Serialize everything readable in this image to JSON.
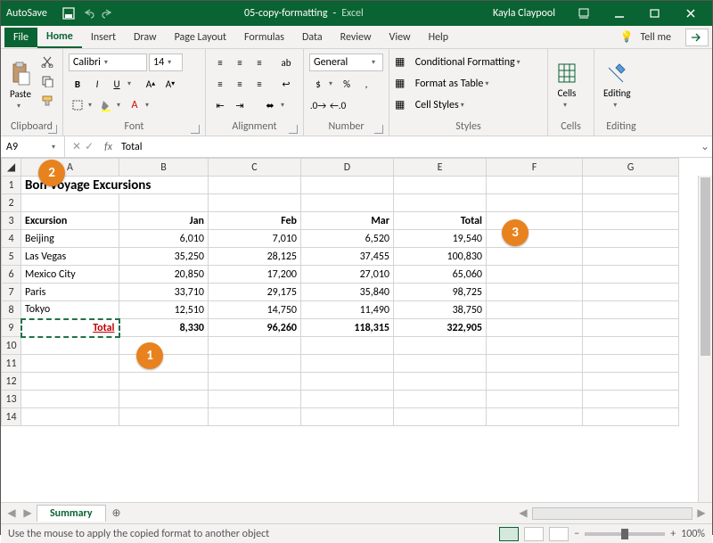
{
  "titlebar": {
    "autosave": "AutoSave",
    "doc": "05-copy-formatting",
    "app": "Excel",
    "user": "Kayla Claypool"
  },
  "menu": {
    "file": "File",
    "home": "Home",
    "insert": "Insert",
    "draw": "Draw",
    "pagelayout": "Page Layout",
    "formulas": "Formulas",
    "data": "Data",
    "review": "Review",
    "view": "View",
    "help": "Help",
    "tellme": "Tell me"
  },
  "ribbon": {
    "clipboard": {
      "label": "Clipboard",
      "paste": "Paste"
    },
    "font": {
      "label": "Font",
      "name": "Calibri",
      "size": "14"
    },
    "alignment": {
      "label": "Alignment"
    },
    "number": {
      "label": "Number",
      "format": "General"
    },
    "styles": {
      "label": "Styles",
      "cond": "Conditional Formatting",
      "table": "Format as Table",
      "cell": "Cell Styles"
    },
    "cells": {
      "label": "Cells",
      "btn": "Cells"
    },
    "editing": {
      "label": "Editing",
      "btn": "Editing"
    }
  },
  "namebox": {
    "ref": "A9",
    "value": "Total"
  },
  "cols": [
    "A",
    "B",
    "C",
    "D",
    "E",
    "F",
    "G"
  ],
  "sheet": {
    "title": "Bon Voyage Excursions",
    "headers": {
      "a": "Excursion",
      "b": "Jan",
      "c": "Feb",
      "d": "Mar",
      "e": "Total"
    },
    "rows": [
      {
        "a": "Beijing",
        "b": "6,010",
        "c": "7,010",
        "d": "6,520",
        "e": "19,540"
      },
      {
        "a": "Las Vegas",
        "b": "35,250",
        "c": "28,125",
        "d": "37,455",
        "e": "100,830"
      },
      {
        "a": "Mexico City",
        "b": "20,850",
        "c": "17,200",
        "d": "27,010",
        "e": "65,060"
      },
      {
        "a": "Paris",
        "b": "33,710",
        "c": "29,175",
        "d": "35,840",
        "e": "98,725"
      },
      {
        "a": "Tokyo",
        "b": "12,510",
        "c": "14,750",
        "d": "11,490",
        "e": "38,750"
      }
    ],
    "totals": {
      "a": "Total",
      "b": "8,330",
      "c": "96,260",
      "d": "118,315",
      "e": "322,905"
    }
  },
  "tabs": {
    "sheet": "Summary"
  },
  "status": {
    "msg": "Use the mouse to apply the copied format to another object",
    "zoom": "100%"
  },
  "callouts": {
    "c1": "1",
    "c2": "2",
    "c3": "3"
  }
}
